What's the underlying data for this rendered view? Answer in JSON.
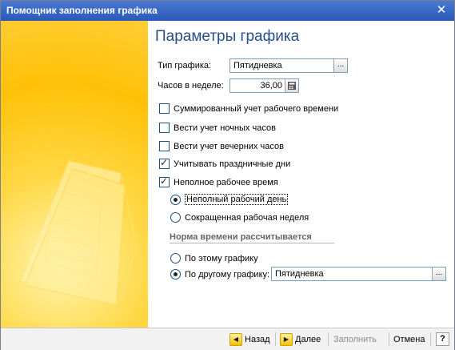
{
  "window": {
    "title": "Помощник заполнения графика",
    "close_glyph": "✕"
  },
  "main": {
    "heading": "Параметры графика",
    "schedule_type": {
      "label": "Тип графика:",
      "value": "Пятидневка",
      "button": "..."
    },
    "hours_week": {
      "label": "Часов в неделе:",
      "value": "36,00",
      "calc_icon": "calculator-icon"
    },
    "options": [
      {
        "label": "Суммированный учет рабочего времени",
        "checked": false
      },
      {
        "label": "Вести учет ночных часов",
        "checked": false
      },
      {
        "label": "Вести учет вечерних часов",
        "checked": false
      },
      {
        "label": "Учитывать праздничные дни",
        "checked": true
      },
      {
        "label": "Неполное рабочее время",
        "checked": true
      }
    ],
    "parttime": [
      {
        "label": "Неполный рабочий день",
        "selected": true
      },
      {
        "label": "Сокращенная рабочая неделя",
        "selected": false
      }
    ],
    "norm_section": {
      "title": "Норма времени рассчитывается",
      "this_schedule": "По этому графику",
      "other_schedule": "По другому графику:",
      "other_value": "Пятидневка",
      "button": "..."
    }
  },
  "footer": {
    "back": "Назад",
    "next": "Далее",
    "fill": "Заполнить",
    "cancel": "Отмена",
    "help": "?"
  },
  "colors": {
    "accent_yellow": "#ffc107",
    "title_blue": "#274e88",
    "titlebar": "#2a59b8"
  }
}
